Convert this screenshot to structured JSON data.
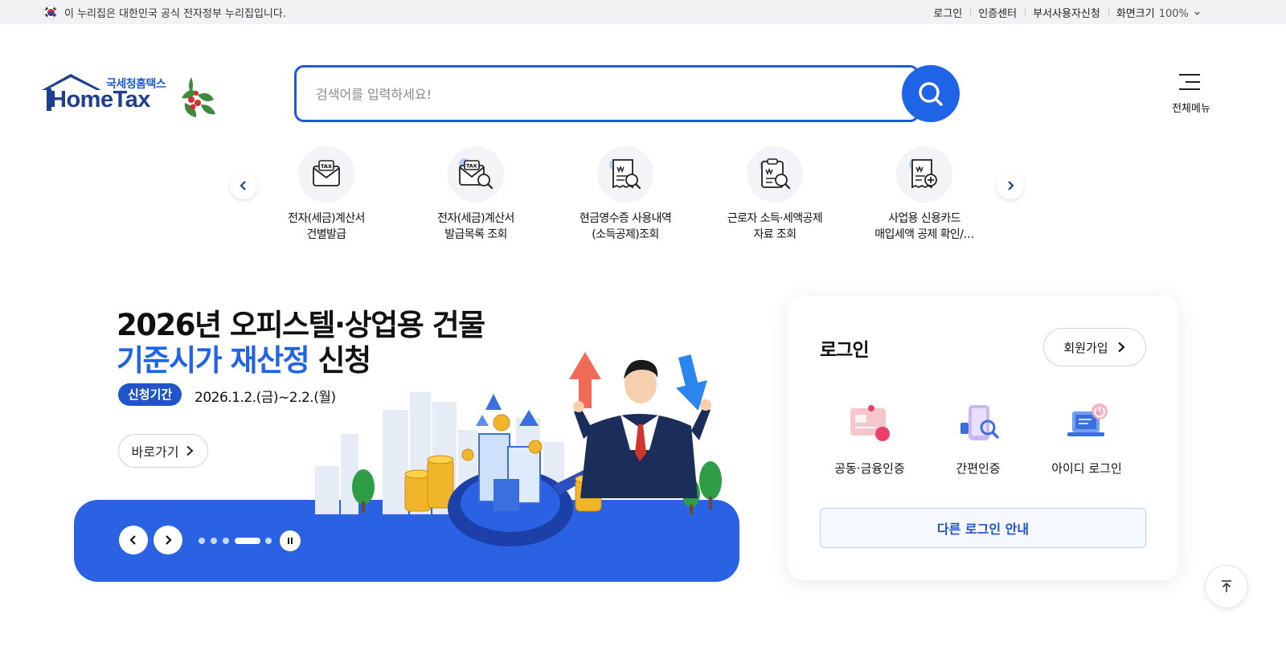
{
  "gov_bar": {
    "notice": "이 누리집은 대한민국 공식 전자정부 누리집입니다.",
    "links": [
      "로그인",
      "인증센터",
      "부서사용자신청"
    ],
    "zoom_label": "화면크기",
    "zoom_value": "100%"
  },
  "header": {
    "logo_sub": "국세청홈택스",
    "logo_main": "HomeTax",
    "search_placeholder": "검색어를 입력하세요!",
    "all_menu_label": "전체메뉴"
  },
  "quick_menu": [
    {
      "line1": "전자(세금)계산서",
      "line2": "건별발급",
      "icon": "tax-invoice-envelope-icon"
    },
    {
      "line1": "전자(세금)계산서",
      "line2": "발급목록 조회",
      "icon": "tax-invoice-search-icon"
    },
    {
      "line1": "현금영수증 사용내역",
      "line2": "(소득공제)조회",
      "icon": "cash-receipt-search-icon"
    },
    {
      "line1": "근로자 소득·세액공제",
      "line2": "자료 조회",
      "icon": "deduction-document-search-icon"
    },
    {
      "line1": "사업용 신용카드",
      "line2": "매입세액 공제 확인/…",
      "icon": "credit-card-receipt-icon"
    }
  ],
  "banner": {
    "title_line1": "2026년 오피스텔·상업용 건물",
    "title_line2_highlight": "기준시가 재산정",
    "title_line2_rest": " 신청",
    "badge": "신청기간",
    "period": "2026.1.2.(금)~2.2.(월)",
    "go_button": "바로가기",
    "slide_count": 5,
    "active_slide": 4
  },
  "login": {
    "title": "로그인",
    "join_button": "회원가입",
    "options": [
      "공동·금융인증",
      "간편인증",
      "아이디 로그인"
    ],
    "other_button": "다른 로그인 안내"
  },
  "colors": {
    "brand_blue": "#1f63e6",
    "banner_base": "#2a62e3",
    "logo_navy": "#1e3f8e"
  }
}
